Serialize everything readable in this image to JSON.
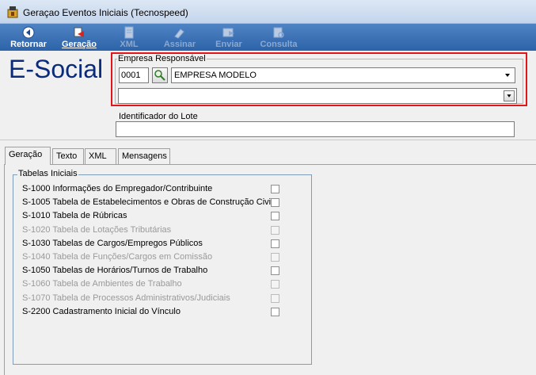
{
  "window": {
    "title": "Geraçao Eventos Iniciais (Tecnospeed)"
  },
  "toolbar": {
    "buttons": [
      {
        "label": "Retornar",
        "icon": "back-arrow-icon",
        "enabled": true
      },
      {
        "label": "Geração",
        "icon": "generate-icon",
        "enabled": true
      },
      {
        "label": "XML",
        "icon": "xml-file-icon",
        "enabled": false
      },
      {
        "label": "Assinar",
        "icon": "sign-icon",
        "enabled": false
      },
      {
        "label": "Enviar",
        "icon": "send-icon",
        "enabled": false
      },
      {
        "label": "Consulta",
        "icon": "query-icon",
        "enabled": false
      }
    ]
  },
  "header": {
    "logo": "E-Social",
    "empresa": {
      "legend": "Empresa Responsável",
      "code": "0001",
      "name": "EMPRESA MODELO",
      "second_value": ""
    },
    "lote": {
      "label": "Identificador do Lote",
      "value": ""
    }
  },
  "tabs": [
    {
      "label": "Geração",
      "active": true
    },
    {
      "label": "Texto",
      "active": false
    },
    {
      "label": "XML",
      "active": false
    },
    {
      "label": "Mensagens",
      "active": false
    }
  ],
  "tabelas": {
    "legend": "Tabelas Iniciais",
    "items": [
      {
        "label": "S-1000 Informações do Empregador/Contribuinte",
        "enabled": true,
        "checked": false
      },
      {
        "label": "S-1005 Tabela de Estabelecimentos e Obras de Construção Civil",
        "enabled": true,
        "checked": false
      },
      {
        "label": "S-1010 Tabela de Rúbricas",
        "enabled": true,
        "checked": false
      },
      {
        "label": "S-1020 Tabela de Lotações Tributárias",
        "enabled": false,
        "checked": false
      },
      {
        "label": "S-1030 Tabelas de Cargos/Empregos Públicos",
        "enabled": true,
        "checked": false
      },
      {
        "label": "S-1040 Tabela de Funções/Cargos em Comissão",
        "enabled": false,
        "checked": false
      },
      {
        "label": "S-1050 Tabelas de Horários/Turnos de Trabalho",
        "enabled": true,
        "checked": false
      },
      {
        "label": "S-1060 Tabela de Ambientes de Trabalho",
        "enabled": false,
        "checked": false
      },
      {
        "label": "S-1070 Tabela de Processos Administrativos/Judiciais",
        "enabled": false,
        "checked": false
      },
      {
        "label": "S-2200 Cadastramento Inicial do Vínculo",
        "enabled": true,
        "checked": false
      }
    ]
  },
  "colors": {
    "toolbar": "#2d63a8",
    "logo": "#0a2b7a",
    "highlight": "#e0161b"
  }
}
